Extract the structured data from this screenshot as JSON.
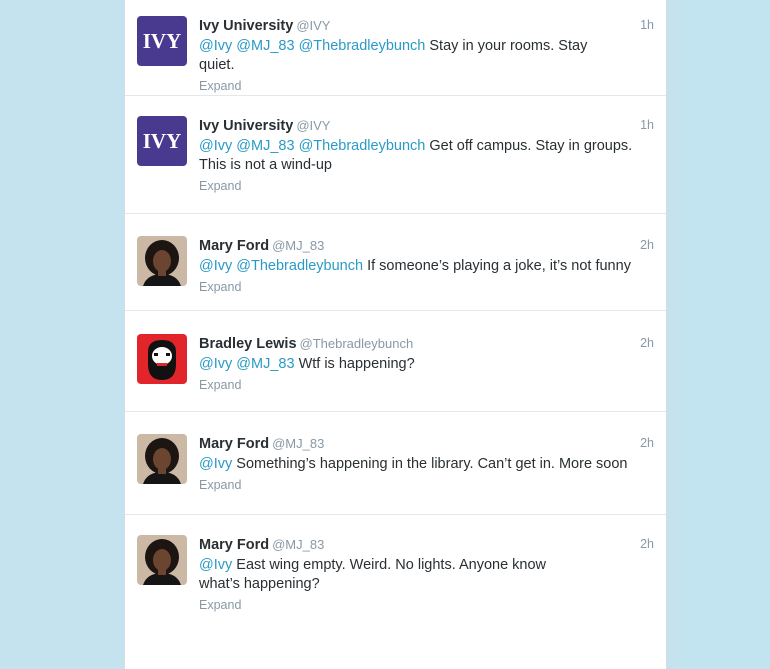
{
  "timeline": {
    "tweets": [
      {
        "name": "Ivy University",
        "handle": "@IVY",
        "time": "1h",
        "avatar": "ivy-logo",
        "mentions": [
          "@Ivy",
          "@MJ_83",
          "@Thebradleybunch"
        ],
        "text": "Stay in your rooms. Stay quiet.",
        "expand": "Expand"
      },
      {
        "name": "Ivy University",
        "handle": "@IVY",
        "time": "1h",
        "avatar": "ivy-logo",
        "mentions": [
          "@Ivy",
          "@MJ_83",
          "@Thebradleybunch"
        ],
        "text": "Get off campus. Stay in groups.",
        "text_line2": "This is not a wind-up",
        "expand": "Expand"
      },
      {
        "name": "Mary Ford",
        "handle": "@MJ_83",
        "time": "2h",
        "avatar": "mary-photo",
        "mentions": [
          "@Ivy",
          "@Thebradleybunch"
        ],
        "text": "If someone’s playing a joke, it’s not funny",
        "expand": "Expand"
      },
      {
        "name": "Bradley Lewis",
        "handle": "@Thebradleybunch",
        "time": "2h",
        "avatar": "bearded-man",
        "mentions": [
          "@Ivy",
          "@MJ_83"
        ],
        "text": "Wtf is happening?",
        "expand": "Expand"
      },
      {
        "name": "Mary Ford",
        "handle": "@MJ_83",
        "time": "2h",
        "avatar": "mary-photo",
        "mentions": [
          "@Ivy"
        ],
        "text": "Something’s happening in the library. Can’t get in. More soon",
        "expand": "Expand"
      },
      {
        "name": "Mary Ford",
        "handle": "@MJ_83",
        "time": "2h",
        "avatar": "mary-photo",
        "mentions": [
          "@Ivy"
        ],
        "text": "East wing empty. Weird. No lights. Anyone know",
        "text_line2": "what’s happening?",
        "expand": "Expand"
      }
    ]
  },
  "avatar_labels": {
    "ivy": "IVY"
  },
  "colors": {
    "background": "#c5e3ef",
    "mention": "#2a9bc6",
    "ivy_brand": "#4a3a8f",
    "bradley_brand": "#e2252b"
  }
}
